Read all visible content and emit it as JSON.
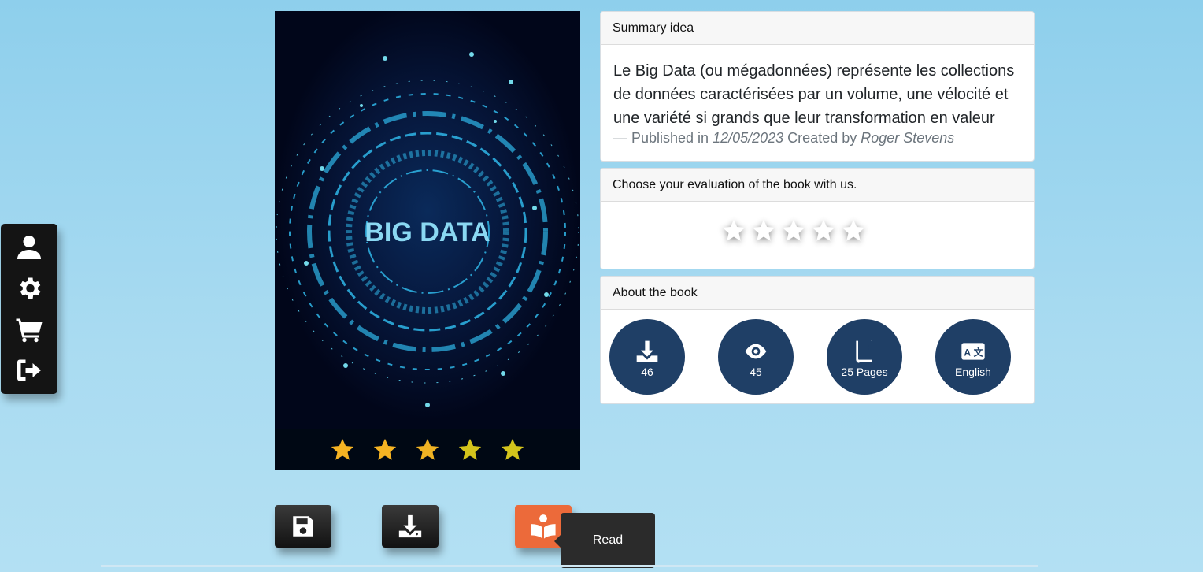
{
  "side_menu": {
    "items": [
      {
        "icon": "user-icon"
      },
      {
        "icon": "gear-icon"
      },
      {
        "icon": "cart-icon"
      },
      {
        "icon": "logout-icon"
      }
    ]
  },
  "cover": {
    "title_text": "BIG DATA",
    "rating_stars": 5,
    "star_colors": [
      "#f5b323",
      "#f5b323",
      "#f0b324",
      "#d4c41c",
      "#d4c41c"
    ]
  },
  "actions": {
    "save_icon": "floppy-disk-icon",
    "download_icon": "download-icon",
    "read_icon": "book-reader-icon",
    "read_tooltip": "Read"
  },
  "summary": {
    "header": "Summary idea",
    "text": "Le Big Data (ou mégadonnées) représente les collections de données caractérisées par un volume, une vélocité et une variété si grands que leur transformation en valeur",
    "meta_prefix": "— Published in ",
    "date": "12/05/2023",
    "meta_mid": " Created by ",
    "author": "Roger Stevens"
  },
  "evaluation": {
    "header": "Choose your evaluation of the book with us.",
    "stars": 5
  },
  "about": {
    "header": "About the book",
    "items": [
      {
        "icon": "download-icon",
        "label": "46"
      },
      {
        "icon": "eye-icon",
        "label": "45"
      },
      {
        "icon": "book-icon",
        "label": "25 Pages"
      },
      {
        "icon": "language-icon",
        "label": "English"
      }
    ]
  },
  "colors": {
    "accent_dark": "#1f3f66",
    "read_button": "#ec6a3a",
    "background": "#a9dbf1"
  }
}
